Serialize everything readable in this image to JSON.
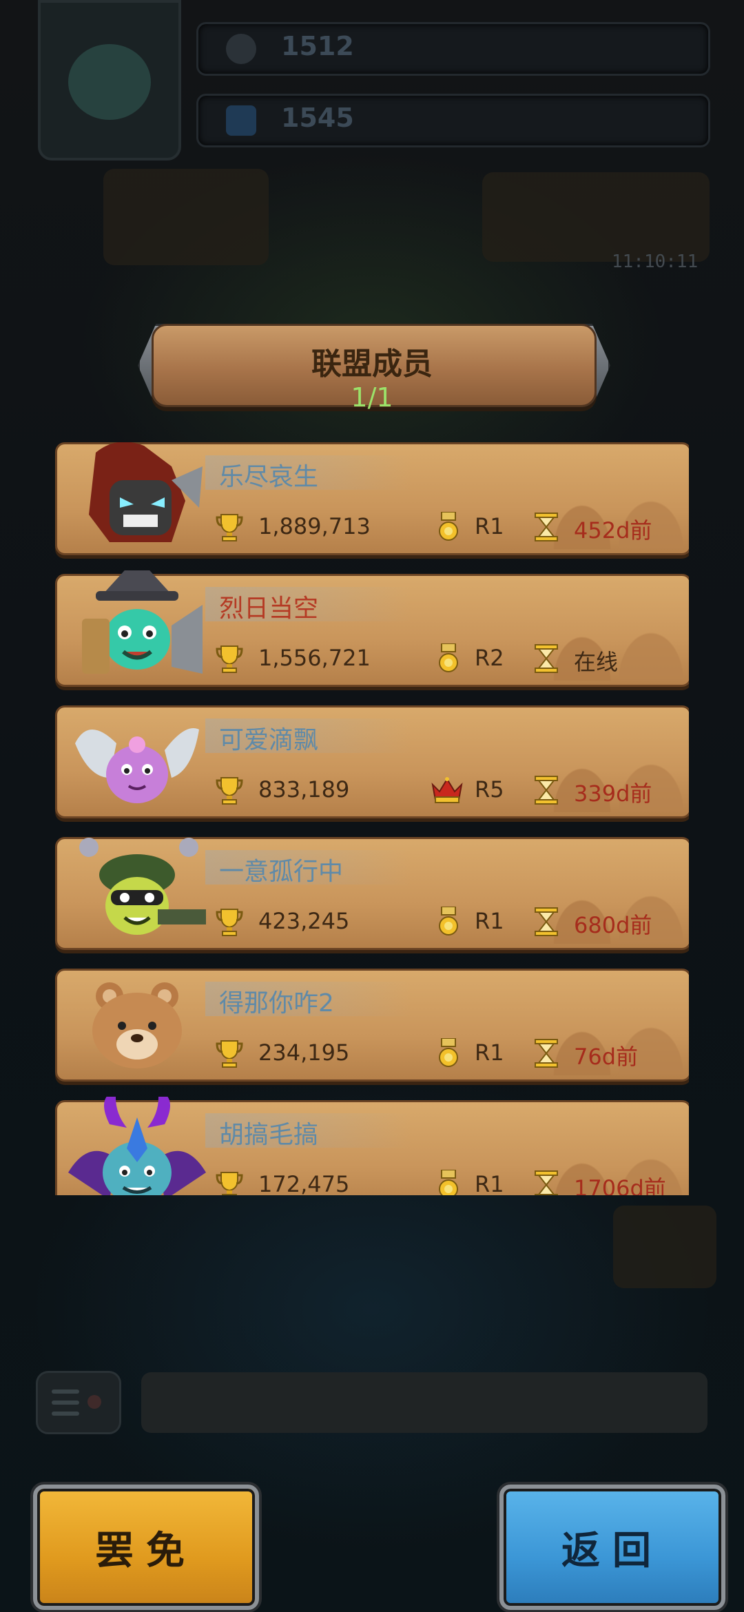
{
  "resources": {
    "coins": "1512",
    "gems": "1545"
  },
  "timer": "11:10:11",
  "header": {
    "title": "联盟成员",
    "count": "1/1"
  },
  "members": [
    {
      "name": "乐尽哀生",
      "name_color": "blue",
      "trophies": "1,889,713",
      "rank": "R1",
      "rank_icon": "medal-icon",
      "last_seen": "452d前",
      "online": false,
      "avatar": "red-hair-warrior-avatar"
    },
    {
      "name": "烈日当空",
      "name_color": "red",
      "trophies": "1,556,721",
      "rank": "R2",
      "rank_icon": "medal-icon",
      "last_seen": "在线",
      "online": true,
      "avatar": "hat-gunner-avatar"
    },
    {
      "name": "可爱滴飘",
      "name_color": "blue",
      "trophies": "833,189",
      "rank": "R5",
      "rank_icon": "crown-icon",
      "last_seen": "339d前",
      "online": false,
      "avatar": "pink-winged-blob-avatar"
    },
    {
      "name": "一意孤行中",
      "name_color": "blue",
      "trophies": "423,245",
      "rank": "R1",
      "rank_icon": "medal-icon",
      "last_seen": "680d前",
      "online": false,
      "avatar": "green-soldier-avatar"
    },
    {
      "name": "得那你咋2",
      "name_color": "blue",
      "trophies": "234,195",
      "rank": "R1",
      "rank_icon": "medal-icon",
      "last_seen": "76d前",
      "online": false,
      "avatar": "bear-avatar"
    },
    {
      "name": "胡搞毛搞",
      "name_color": "blue",
      "trophies": "172,475",
      "rank": "R1",
      "rank_icon": "medal-icon",
      "last_seen": "1706d前",
      "online": false,
      "avatar": "purple-demon-avatar"
    }
  ],
  "buttons": {
    "dismiss": "罢免",
    "back": "返回"
  },
  "colors": {
    "card": "#c9955b",
    "name_blue": "#5f8aa8",
    "name_red": "#b53a24",
    "offline_red": "#a62c1c",
    "count_green": "#9be26a",
    "dismiss_button": "#e09a1e",
    "back_button": "#3b96d6"
  }
}
